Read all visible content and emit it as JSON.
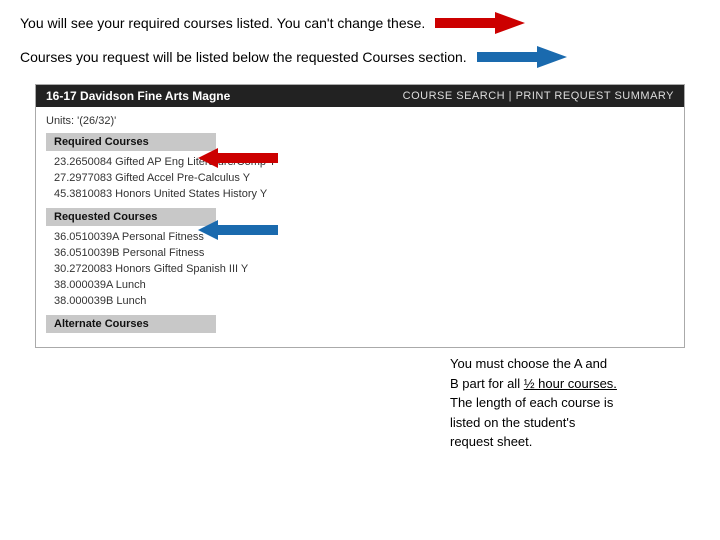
{
  "intro": {
    "line1": "You will see your required courses listed.  You can't change these.",
    "line2": "Courses you request will be listed  below the requested Courses section."
  },
  "school_name": "16-17 Davidson Fine Arts Magne",
  "nav_links": "COURSE SEARCH  |  PRINT REQUEST SUMMARY",
  "units_label": "Units: '(26/32)'",
  "sections": [
    {
      "header": "Required Courses",
      "courses": [
        "23.2650084 Gifted AP Eng Literature/Comp Y",
        "27.2977083 Gifted Accel Pre-Calculus Y",
        "45.3810083 Honors United States History Y"
      ]
    },
    {
      "header": "Requested Courses",
      "courses": [
        "36.0510039A Personal Fitness",
        "36.0510039B Personal Fitness",
        "30.2720083 Honors Gifted Spanish III Y",
        "38.000039A Lunch",
        "38.000039B Lunch"
      ]
    },
    {
      "header": "Alternate Courses",
      "courses": []
    }
  ],
  "right_panel": {
    "text_parts": [
      "You must choose the A and",
      "B part for all ½ hour courses.",
      "The length of each course is",
      "listed on the student's",
      "request sheet."
    ],
    "underlined_word": "½"
  }
}
